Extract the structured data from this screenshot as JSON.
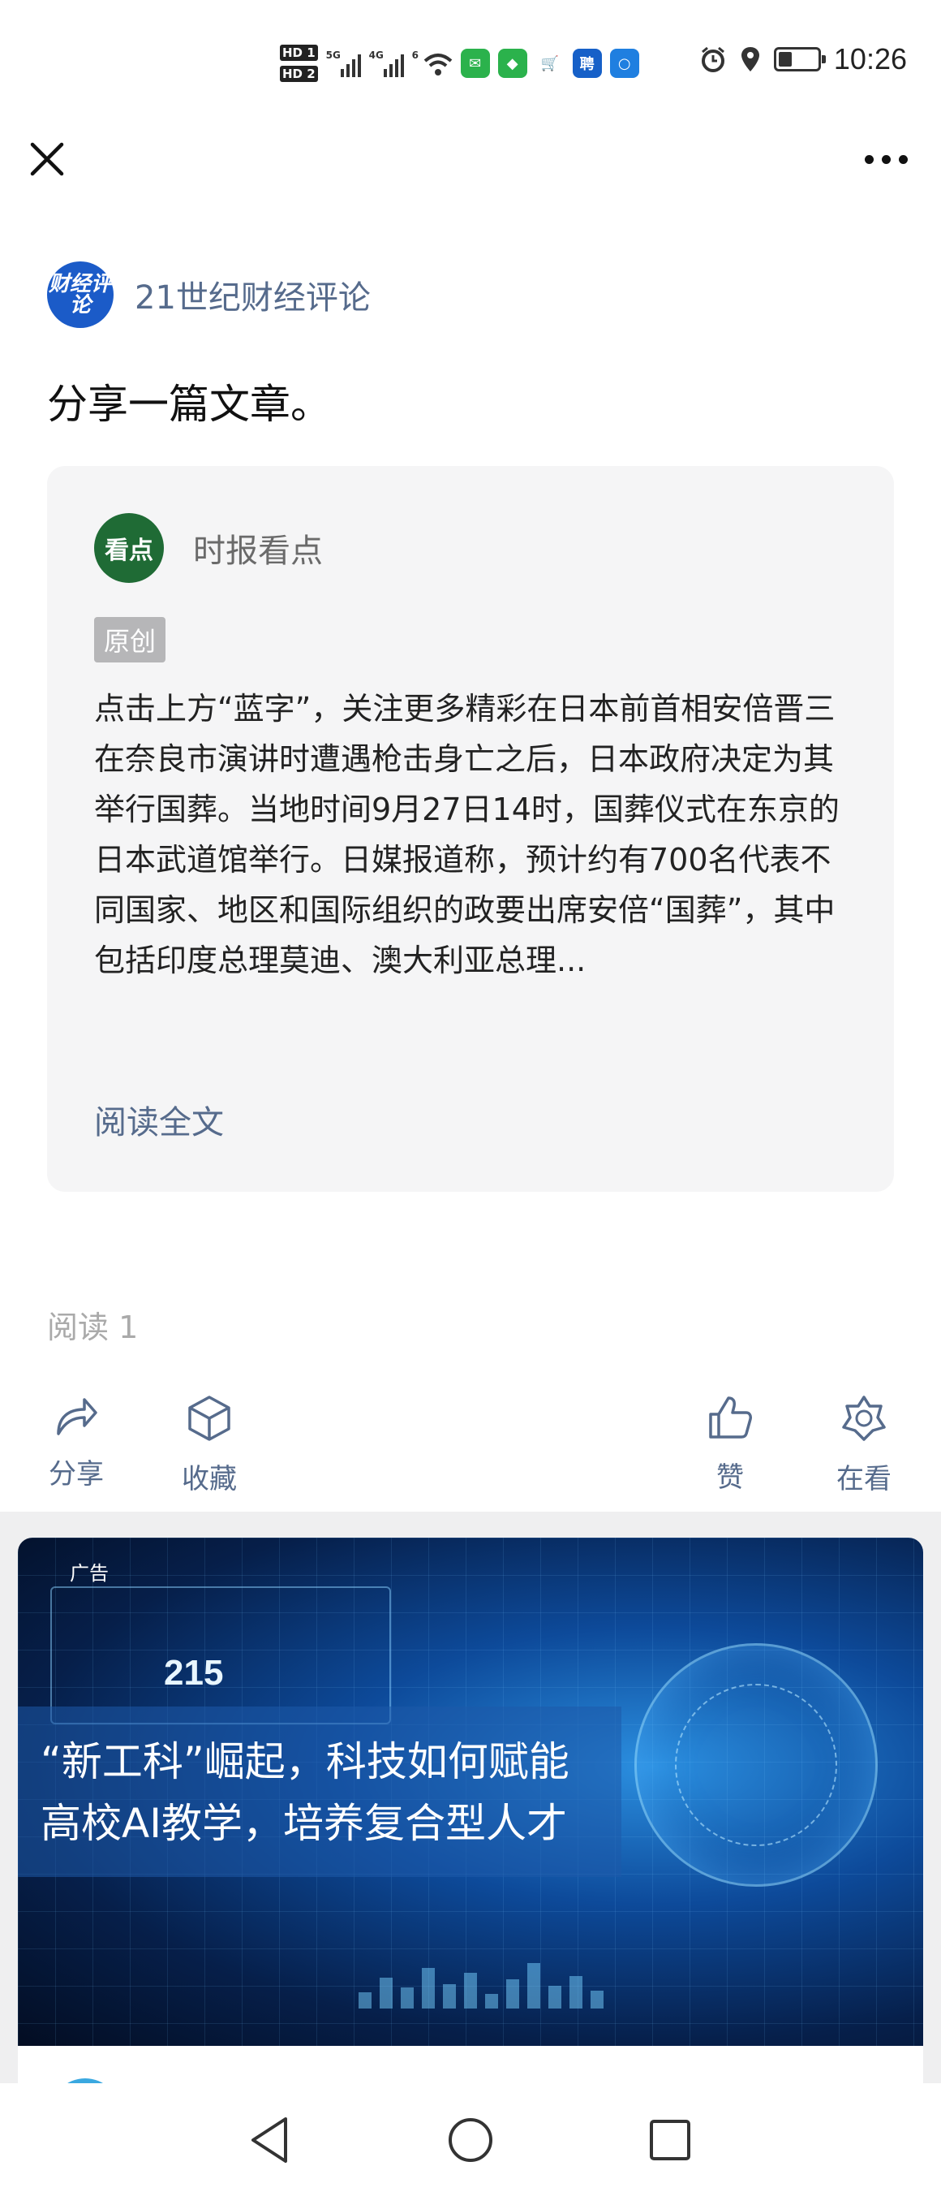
{
  "status_bar": {
    "time": "10:26",
    "hd_labels": [
      "HD 1",
      "HD 2"
    ],
    "network_labels": [
      "5G",
      "4G",
      "6"
    ],
    "app_icons": [
      "wechat-icon",
      "wechat-pay-icon",
      "cart-icon",
      "recruit-icon",
      "bulb-icon"
    ],
    "system_icons": [
      "alarm-icon",
      "location-icon",
      "battery-icon"
    ]
  },
  "author": {
    "avatar_text": "财经评论",
    "name": "21世纪财经评论"
  },
  "share_text": "分享一篇文章。",
  "card": {
    "source_logo_text": "看点",
    "source_name": "时报看点",
    "badge": "原创",
    "excerpt": "点击上方“蓝字”，关注更多精彩在日本前首相安倍晋三在奈良市演讲时遭遇枪击身亡之后，日本政府决定为其举行国葬。当地时间9月27日14时，国葬仪式在东京的日本武道馆举行。日媒报道称，预计约有700名代表不同国家、地区和国际组织的政要出席安倍“国葬”，其中包括印度总理莫迪、澳大利亚总理...",
    "read_full": "阅读全文"
  },
  "read_count": "阅读 1",
  "actions": {
    "share": "分享",
    "favorite": "收藏",
    "like": "赞",
    "wow": "在看"
  },
  "ad": {
    "tag": "广告",
    "hud_number": "215",
    "line1": "“新工科”崛起，科技如何赋能",
    "line2": "高校AI教学，培养复合型人才"
  },
  "colors": {
    "link": "#566b8c",
    "card_bg": "#f5f5f6",
    "avatar_blue": "#1b5bc8",
    "source_green": "#1f6b35"
  }
}
